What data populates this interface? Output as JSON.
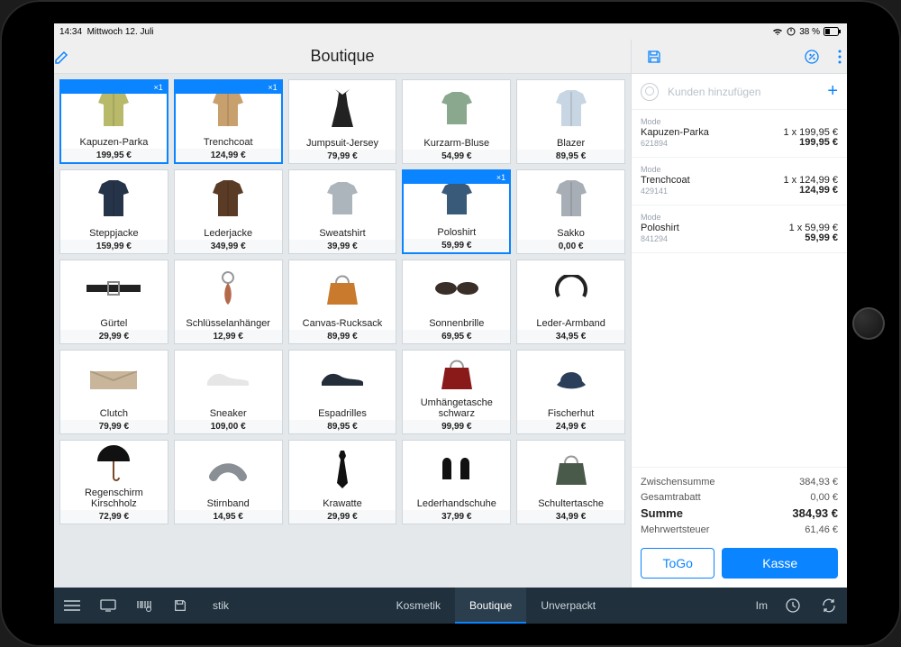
{
  "status": {
    "time": "14:34",
    "date": "Mittwoch 12. Juli",
    "battery": "38 %"
  },
  "header": {
    "title": "Boutique"
  },
  "customer": {
    "placeholder": "Kunden hinzufügen"
  },
  "products": [
    {
      "name": "Kapuzen-Parka",
      "price": "199,95 €",
      "selected": true,
      "badge": "×1",
      "color": "#b9b96a",
      "shape": "jacket"
    },
    {
      "name": "Trenchcoat",
      "price": "124,99 €",
      "selected": true,
      "badge": "×1",
      "color": "#c8a06d",
      "shape": "coat"
    },
    {
      "name": "Jumpsuit-Jersey",
      "price": "79,99 €",
      "selected": false,
      "badge": "",
      "color": "#222",
      "shape": "dress"
    },
    {
      "name": "Kurzarm-Bluse",
      "price": "54,99 €",
      "selected": false,
      "badge": "",
      "color": "#8aa88d",
      "shape": "top"
    },
    {
      "name": "Blazer",
      "price": "89,95 €",
      "selected": false,
      "badge": "",
      "color": "#c7d6e2",
      "shape": "blazer"
    },
    {
      "name": "Steppjacke",
      "price": "159,99 €",
      "selected": false,
      "badge": "",
      "color": "#26344a",
      "shape": "jacket"
    },
    {
      "name": "Lederjacke",
      "price": "349,99 €",
      "selected": false,
      "badge": "",
      "color": "#5a3b26",
      "shape": "jacket"
    },
    {
      "name": "Sweatshirt",
      "price": "39,99 €",
      "selected": false,
      "badge": "",
      "color": "#acb5bb",
      "shape": "top"
    },
    {
      "name": "Poloshirt",
      "price": "59,99 €",
      "selected": true,
      "badge": "×1",
      "color": "#3a5a7a",
      "shape": "top"
    },
    {
      "name": "Sakko",
      "price": "0,00 €",
      "selected": false,
      "badge": "",
      "color": "#a7aeb5",
      "shape": "blazer"
    },
    {
      "name": "Gürtel",
      "price": "29,99 €",
      "selected": false,
      "badge": "",
      "color": "#222",
      "shape": "belt"
    },
    {
      "name": "Schlüsselanhänger",
      "price": "12,99 €",
      "selected": false,
      "badge": "",
      "color": "#b5694b",
      "shape": "keychain"
    },
    {
      "name": "Canvas-Rucksack",
      "price": "89,99 €",
      "selected": false,
      "badge": "",
      "color": "#c97a2d",
      "shape": "bag"
    },
    {
      "name": "Sonnenbrille",
      "price": "69,95 €",
      "selected": false,
      "badge": "",
      "color": "#3a2f28",
      "shape": "glasses"
    },
    {
      "name": "Leder-Armband",
      "price": "34,95 €",
      "selected": false,
      "badge": "",
      "color": "#222",
      "shape": "bracelet"
    },
    {
      "name": "Clutch",
      "price": "79,99 €",
      "selected": false,
      "badge": "",
      "color": "#c9b69a",
      "shape": "clutch"
    },
    {
      "name": "Sneaker",
      "price": "109,00 €",
      "selected": false,
      "badge": "",
      "color": "#e6e6e6",
      "shape": "shoe"
    },
    {
      "name": "Espadrilles",
      "price": "89,95 €",
      "selected": false,
      "badge": "",
      "color": "#242d3a",
      "shape": "shoe"
    },
    {
      "name": "Umhängetasche schwarz",
      "price": "99,99 €",
      "selected": false,
      "badge": "",
      "color": "#8a1a1a",
      "shape": "bag"
    },
    {
      "name": "Fischerhut",
      "price": "24,99 €",
      "selected": false,
      "badge": "",
      "color": "#2b3e5a",
      "shape": "hat"
    },
    {
      "name": "Regenschirm Kirschholz",
      "price": "72,99 €",
      "selected": false,
      "badge": "",
      "color": "#111",
      "shape": "umbrella"
    },
    {
      "name": "Stirnband",
      "price": "14,95 €",
      "selected": false,
      "badge": "",
      "color": "#8a8f95",
      "shape": "headband"
    },
    {
      "name": "Krawatte",
      "price": "29,99 €",
      "selected": false,
      "badge": "",
      "color": "#111",
      "shape": "tie"
    },
    {
      "name": "Lederhandschuhe",
      "price": "37,99 €",
      "selected": false,
      "badge": "",
      "color": "#111",
      "shape": "gloves"
    },
    {
      "name": "Schultertasche",
      "price": "34,99 €",
      "selected": false,
      "badge": "",
      "color": "#4a5a4a",
      "shape": "bag"
    }
  ],
  "cart": {
    "items": [
      {
        "category": "Mode",
        "name": "Kapuzen-Parka",
        "qty_price": "1 x 199,95 €",
        "sku": "621894",
        "total": "199,95 €"
      },
      {
        "category": "Mode",
        "name": "Trenchcoat",
        "qty_price": "1 x 124,99 €",
        "sku": "429141",
        "total": "124,99 €"
      },
      {
        "category": "Mode",
        "name": "Poloshirt",
        "qty_price": "1 x 59,99 €",
        "sku": "841294",
        "total": "59,99 €"
      }
    ],
    "summary": {
      "subtotal_label": "Zwischensumme",
      "subtotal": "384,93 €",
      "discount_label": "Gesamtrabatt",
      "discount": "0,00 €",
      "total_label": "Summe",
      "total": "384,93 €",
      "tax_label": "Mehrwertsteuer",
      "tax": "61,46 €"
    },
    "buttons": {
      "togo": "ToGo",
      "checkout": "Kasse"
    }
  },
  "tabs": {
    "stik": "stik",
    "kosmetik": "Kosmetik",
    "boutique": "Boutique",
    "unverpackt": "Unverpackt",
    "im": "Im"
  }
}
